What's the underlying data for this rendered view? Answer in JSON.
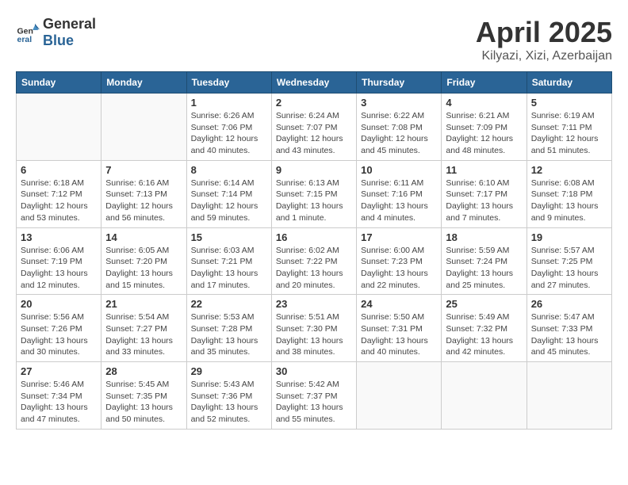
{
  "header": {
    "logo_general": "General",
    "logo_blue": "Blue",
    "month": "April 2025",
    "location": "Kilyazi, Xizi, Azerbaijan"
  },
  "weekdays": [
    "Sunday",
    "Monday",
    "Tuesday",
    "Wednesday",
    "Thursday",
    "Friday",
    "Saturday"
  ],
  "weeks": [
    [
      {
        "day": "",
        "sunrise": "",
        "sunset": "",
        "daylight": ""
      },
      {
        "day": "",
        "sunrise": "",
        "sunset": "",
        "daylight": ""
      },
      {
        "day": "1",
        "sunrise": "Sunrise: 6:26 AM",
        "sunset": "Sunset: 7:06 PM",
        "daylight": "Daylight: 12 hours and 40 minutes."
      },
      {
        "day": "2",
        "sunrise": "Sunrise: 6:24 AM",
        "sunset": "Sunset: 7:07 PM",
        "daylight": "Daylight: 12 hours and 43 minutes."
      },
      {
        "day": "3",
        "sunrise": "Sunrise: 6:22 AM",
        "sunset": "Sunset: 7:08 PM",
        "daylight": "Daylight: 12 hours and 45 minutes."
      },
      {
        "day": "4",
        "sunrise": "Sunrise: 6:21 AM",
        "sunset": "Sunset: 7:09 PM",
        "daylight": "Daylight: 12 hours and 48 minutes."
      },
      {
        "day": "5",
        "sunrise": "Sunrise: 6:19 AM",
        "sunset": "Sunset: 7:11 PM",
        "daylight": "Daylight: 12 hours and 51 minutes."
      }
    ],
    [
      {
        "day": "6",
        "sunrise": "Sunrise: 6:18 AM",
        "sunset": "Sunset: 7:12 PM",
        "daylight": "Daylight: 12 hours and 53 minutes."
      },
      {
        "day": "7",
        "sunrise": "Sunrise: 6:16 AM",
        "sunset": "Sunset: 7:13 PM",
        "daylight": "Daylight: 12 hours and 56 minutes."
      },
      {
        "day": "8",
        "sunrise": "Sunrise: 6:14 AM",
        "sunset": "Sunset: 7:14 PM",
        "daylight": "Daylight: 12 hours and 59 minutes."
      },
      {
        "day": "9",
        "sunrise": "Sunrise: 6:13 AM",
        "sunset": "Sunset: 7:15 PM",
        "daylight": "Daylight: 13 hours and 1 minute."
      },
      {
        "day": "10",
        "sunrise": "Sunrise: 6:11 AM",
        "sunset": "Sunset: 7:16 PM",
        "daylight": "Daylight: 13 hours and 4 minutes."
      },
      {
        "day": "11",
        "sunrise": "Sunrise: 6:10 AM",
        "sunset": "Sunset: 7:17 PM",
        "daylight": "Daylight: 13 hours and 7 minutes."
      },
      {
        "day": "12",
        "sunrise": "Sunrise: 6:08 AM",
        "sunset": "Sunset: 7:18 PM",
        "daylight": "Daylight: 13 hours and 9 minutes."
      }
    ],
    [
      {
        "day": "13",
        "sunrise": "Sunrise: 6:06 AM",
        "sunset": "Sunset: 7:19 PM",
        "daylight": "Daylight: 13 hours and 12 minutes."
      },
      {
        "day": "14",
        "sunrise": "Sunrise: 6:05 AM",
        "sunset": "Sunset: 7:20 PM",
        "daylight": "Daylight: 13 hours and 15 minutes."
      },
      {
        "day": "15",
        "sunrise": "Sunrise: 6:03 AM",
        "sunset": "Sunset: 7:21 PM",
        "daylight": "Daylight: 13 hours and 17 minutes."
      },
      {
        "day": "16",
        "sunrise": "Sunrise: 6:02 AM",
        "sunset": "Sunset: 7:22 PM",
        "daylight": "Daylight: 13 hours and 20 minutes."
      },
      {
        "day": "17",
        "sunrise": "Sunrise: 6:00 AM",
        "sunset": "Sunset: 7:23 PM",
        "daylight": "Daylight: 13 hours and 22 minutes."
      },
      {
        "day": "18",
        "sunrise": "Sunrise: 5:59 AM",
        "sunset": "Sunset: 7:24 PM",
        "daylight": "Daylight: 13 hours and 25 minutes."
      },
      {
        "day": "19",
        "sunrise": "Sunrise: 5:57 AM",
        "sunset": "Sunset: 7:25 PM",
        "daylight": "Daylight: 13 hours and 27 minutes."
      }
    ],
    [
      {
        "day": "20",
        "sunrise": "Sunrise: 5:56 AM",
        "sunset": "Sunset: 7:26 PM",
        "daylight": "Daylight: 13 hours and 30 minutes."
      },
      {
        "day": "21",
        "sunrise": "Sunrise: 5:54 AM",
        "sunset": "Sunset: 7:27 PM",
        "daylight": "Daylight: 13 hours and 33 minutes."
      },
      {
        "day": "22",
        "sunrise": "Sunrise: 5:53 AM",
        "sunset": "Sunset: 7:28 PM",
        "daylight": "Daylight: 13 hours and 35 minutes."
      },
      {
        "day": "23",
        "sunrise": "Sunrise: 5:51 AM",
        "sunset": "Sunset: 7:30 PM",
        "daylight": "Daylight: 13 hours and 38 minutes."
      },
      {
        "day": "24",
        "sunrise": "Sunrise: 5:50 AM",
        "sunset": "Sunset: 7:31 PM",
        "daylight": "Daylight: 13 hours and 40 minutes."
      },
      {
        "day": "25",
        "sunrise": "Sunrise: 5:49 AM",
        "sunset": "Sunset: 7:32 PM",
        "daylight": "Daylight: 13 hours and 42 minutes."
      },
      {
        "day": "26",
        "sunrise": "Sunrise: 5:47 AM",
        "sunset": "Sunset: 7:33 PM",
        "daylight": "Daylight: 13 hours and 45 minutes."
      }
    ],
    [
      {
        "day": "27",
        "sunrise": "Sunrise: 5:46 AM",
        "sunset": "Sunset: 7:34 PM",
        "daylight": "Daylight: 13 hours and 47 minutes."
      },
      {
        "day": "28",
        "sunrise": "Sunrise: 5:45 AM",
        "sunset": "Sunset: 7:35 PM",
        "daylight": "Daylight: 13 hours and 50 minutes."
      },
      {
        "day": "29",
        "sunrise": "Sunrise: 5:43 AM",
        "sunset": "Sunset: 7:36 PM",
        "daylight": "Daylight: 13 hours and 52 minutes."
      },
      {
        "day": "30",
        "sunrise": "Sunrise: 5:42 AM",
        "sunset": "Sunset: 7:37 PM",
        "daylight": "Daylight: 13 hours and 55 minutes."
      },
      {
        "day": "",
        "sunrise": "",
        "sunset": "",
        "daylight": ""
      },
      {
        "day": "",
        "sunrise": "",
        "sunset": "",
        "daylight": ""
      },
      {
        "day": "",
        "sunrise": "",
        "sunset": "",
        "daylight": ""
      }
    ]
  ]
}
